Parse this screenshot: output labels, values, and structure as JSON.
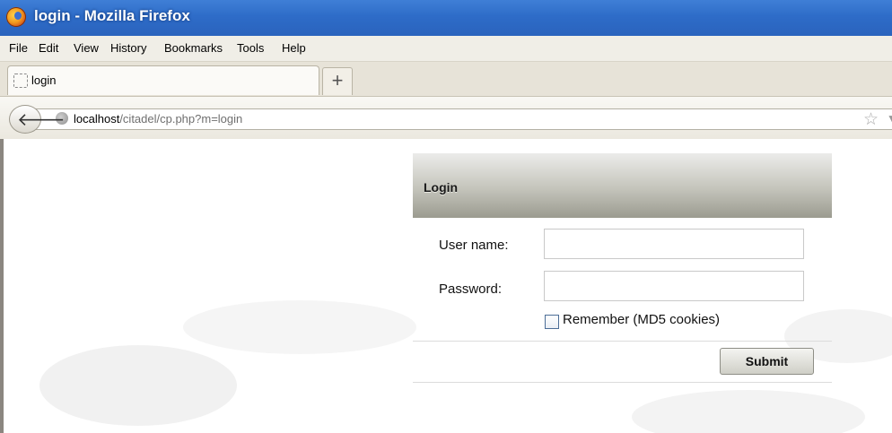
{
  "window": {
    "title": "login - Mozilla Firefox"
  },
  "menu": {
    "items": [
      "File",
      "Edit",
      "View",
      "History",
      "Bookmarks",
      "Tools",
      "Help"
    ]
  },
  "tabs": [
    {
      "label": "login"
    }
  ],
  "newtab": {
    "label": "+"
  },
  "nav": {
    "url_host": "localhost",
    "url_path": "/citadel/cp.php?m=login"
  },
  "login": {
    "title": "Login",
    "username_label": "User name:",
    "password_label": "Password:",
    "remember_label": "Remember (MD5 cookies)",
    "remember_checked": false,
    "submit_label": "Submit",
    "username_value": "",
    "password_value": ""
  }
}
